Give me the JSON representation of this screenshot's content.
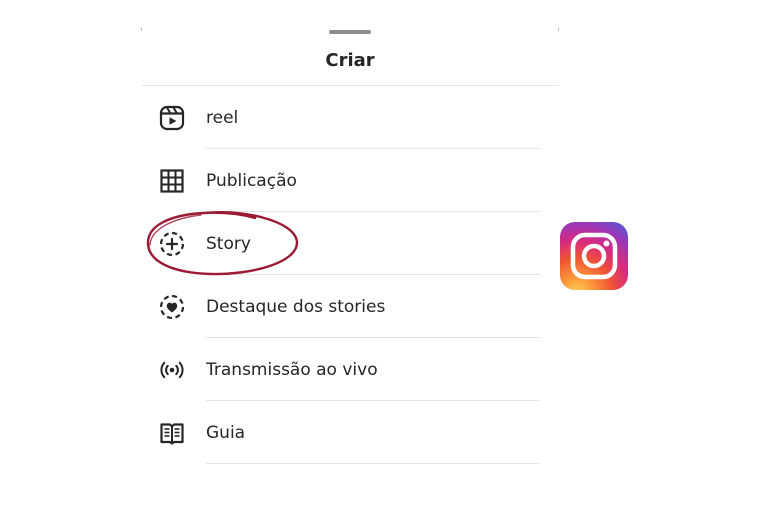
{
  "sheet": {
    "title": "Criar"
  },
  "menu": {
    "items": [
      {
        "label": "reel",
        "icon": "reel-icon"
      },
      {
        "label": "Publicação",
        "icon": "grid-icon"
      },
      {
        "label": "Story",
        "icon": "story-add-icon"
      },
      {
        "label": "Destaque dos stories",
        "icon": "highlight-heart-icon"
      },
      {
        "label": "Transmissão ao vivo",
        "icon": "live-broadcast-icon"
      },
      {
        "label": "Guia",
        "icon": "guide-book-icon"
      }
    ]
  },
  "annotation": {
    "highlighted_item": "Story",
    "circle_color": "#9c1a34"
  },
  "brand": {
    "logo": "instagram-logo-icon"
  },
  "colors": {
    "text": "#262626",
    "divider": "#e6e6e6",
    "handle": "#8e8e8e"
  }
}
